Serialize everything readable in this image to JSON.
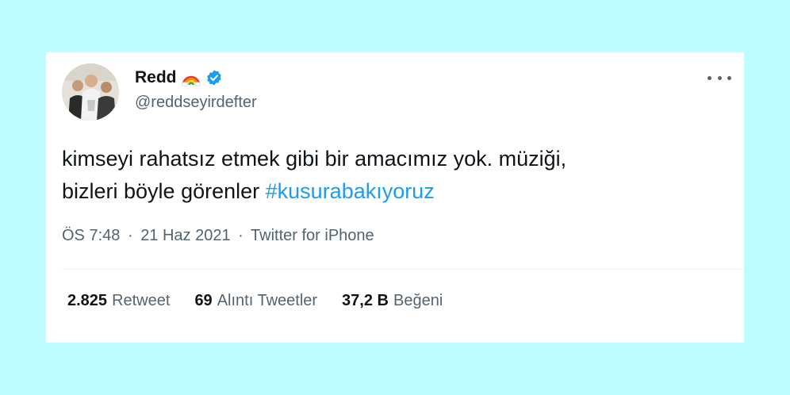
{
  "user": {
    "display_name": "Redd",
    "handle": "@reddseyirdefter",
    "emoji_icon": "rainbow-icon",
    "verified_icon": "verified-badge-icon",
    "verified_color": "#1d9bf0"
  },
  "tweet": {
    "text_line1": "kimseyi rahatsız etmek gibi bir amacımız yok. müziği,",
    "text_line2_prefix": "bizleri böyle görenler ",
    "hashtag": "#kusurabakıyoruz"
  },
  "meta": {
    "time": "ÖS 7:48",
    "separator": "·",
    "date": "21 Haz 2021",
    "source": "Twitter for iPhone"
  },
  "stats": [
    {
      "count": "2.825",
      "label": "Retweet"
    },
    {
      "count": "69",
      "label": "Alıntı Tweetler"
    },
    {
      "count": "37,2 B",
      "label": "Beğeni"
    }
  ],
  "colors": {
    "background": "#bdfdff",
    "link": "#1d9bf0",
    "text_primary": "#0f1419",
    "text_secondary": "#536471"
  }
}
